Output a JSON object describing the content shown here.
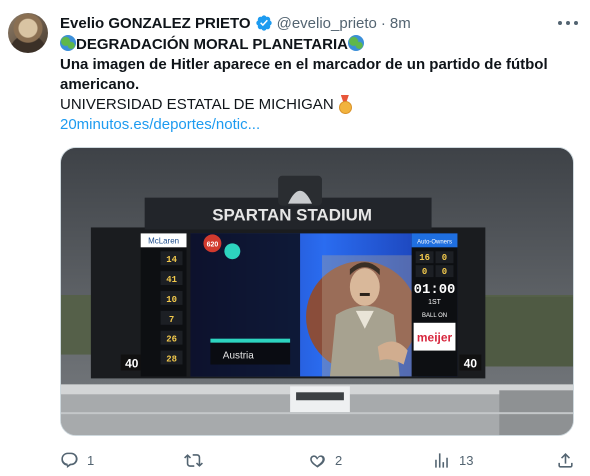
{
  "tweet": {
    "author_name": "Evelio GONZALEZ PRIETO",
    "handle": "@evelio_prieto",
    "separator": "·",
    "timestamp": "8m",
    "headline": "DEGRADACIÓN MORAL PLANETARIA",
    "bold_text": "Una imagen de Hitler aparece en el marcador de un partido de fútbol americano.",
    "subtitle": "UNIVERSIDAD ESTATAL DE MICHIGAN",
    "link_text": "20minutos.es/deportes/notic...",
    "icons": {
      "avatar": "avatar",
      "verified": "verified-badge-icon",
      "more": "more-options-icon",
      "headline_emoji": "globe-icon",
      "subtitle_emoji": "medal-icon"
    }
  },
  "media": {
    "stadium_sign": "SPARTAN STADIUM",
    "sponsor_left": "McLaren",
    "team_label": "Austria",
    "sponsor_right": "meijer",
    "sponsor_top": "Auto-Owners",
    "clock": "01:00",
    "quarter": "1ST",
    "ball_label": "BALL ON",
    "badge_left": "620",
    "side_number_left": "40",
    "side_number_right": "40",
    "stats_left": [
      "14",
      "41",
      "10",
      "7",
      "26",
      "28"
    ],
    "stats_right_top": [
      "16",
      "0"
    ],
    "stats_right_mid": [
      "0",
      "0"
    ]
  },
  "actions": {
    "reply": {
      "icon": "reply-icon",
      "count": "1"
    },
    "retweet": {
      "icon": "retweet-icon",
      "count": ""
    },
    "like": {
      "icon": "like-icon",
      "count": "2"
    },
    "views": {
      "icon": "views-icon",
      "count": "13"
    },
    "share": {
      "icon": "share-icon"
    }
  },
  "colors": {
    "text": "#0f1419",
    "muted": "#536471",
    "link": "#1d9bf0",
    "verified": "#1d9bf0"
  }
}
